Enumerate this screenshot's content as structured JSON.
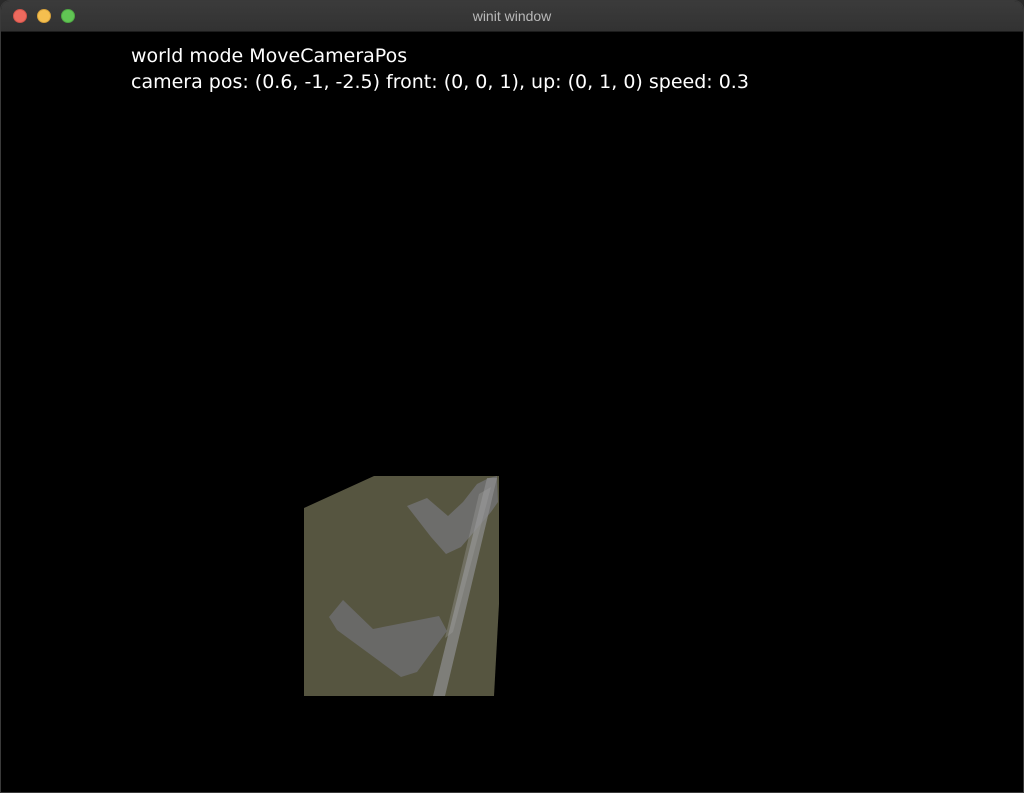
{
  "window": {
    "title": "winit window"
  },
  "hud": {
    "mode_line": "world mode MoveCameraPos",
    "camera_line": "camera pos: (0.6, -1, -2.5) front: (0, 0, 1), up: (0, 1, 0) speed: 0.3"
  },
  "scene": {
    "surface_color": "#565540",
    "stroke_color": "#6e6e6e",
    "light_stroke_color": "#8a8a8a"
  },
  "traffic_lights": {
    "close_color": "#ed6a5e",
    "minimize_color": "#f5bf4f",
    "maximize_color": "#61c554"
  }
}
